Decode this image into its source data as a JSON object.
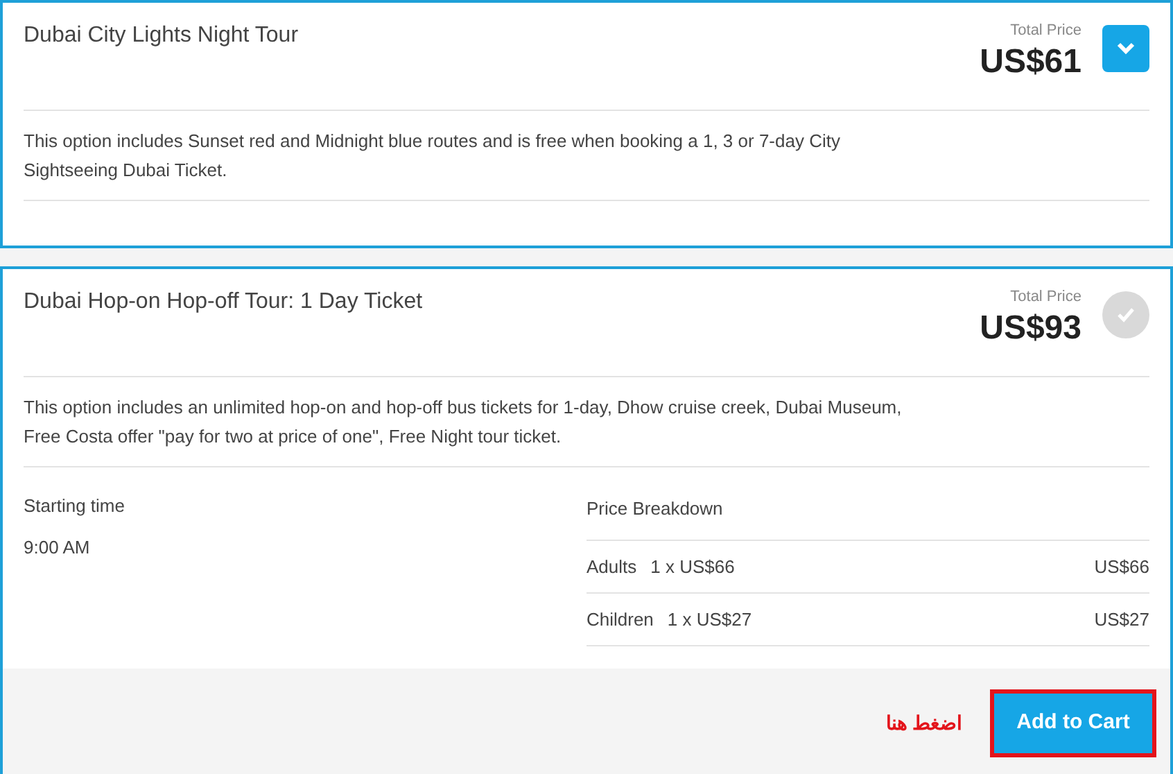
{
  "options": [
    {
      "title": "Dubai City Lights Night Tour",
      "price_label": "Total Price",
      "price": "US$61",
      "kind": "expand",
      "description": "This option includes Sunset red and Midnight blue routes and is free when booking a 1, 3 or 7-day City Sightseeing Dubai Ticket."
    },
    {
      "title": "Dubai Hop-on Hop-off Tour: 1 Day Ticket",
      "price_label": "Total Price",
      "price": "US$93",
      "kind": "check",
      "description": "This option includes an unlimited hop-on and hop-off bus tickets for 1-day, Dhow cruise creek, Dubai Museum, Free Costa offer \"pay for two at price of one\", Free Night tour ticket.",
      "details": {
        "starting_label": "Starting time",
        "starting_time": "9:00 AM",
        "breakdown_title": "Price Breakdown",
        "breakdown": [
          {
            "type": "Adults",
            "quantity": "1 x US$66",
            "amount": "US$66"
          },
          {
            "type": "Children",
            "quantity": "1 x US$27",
            "amount": "US$27"
          }
        ]
      },
      "footer": {
        "annotation": "اضغط هنا",
        "button": "Add to Cart"
      }
    }
  ]
}
